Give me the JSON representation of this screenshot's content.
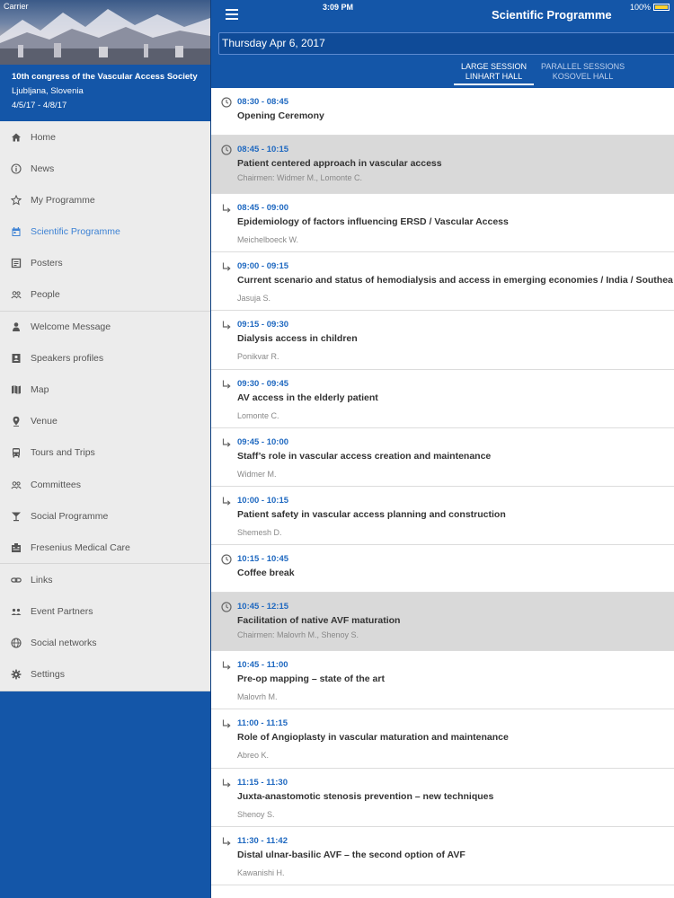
{
  "status_bar": {
    "carrier": "Carrier",
    "time": "3:09 PM",
    "battery": "100%"
  },
  "sidebar": {
    "conference_title": "10th congress of the Vascular Access Society",
    "location": "Ljubljana, Slovenia",
    "dates": "4/5/17 - 4/8/17",
    "groups": [
      [
        {
          "label": "Home",
          "icon": "home-icon"
        },
        {
          "label": "News",
          "icon": "info-icon"
        },
        {
          "label": "My Programme",
          "icon": "star-icon"
        },
        {
          "label": "Scientific Programme",
          "icon": "calendar-icon",
          "active": true
        },
        {
          "label": "Posters",
          "icon": "poster-icon"
        },
        {
          "label": "People",
          "icon": "people-icon"
        }
      ],
      [
        {
          "label": "Welcome Message",
          "icon": "speaker-icon"
        },
        {
          "label": "Speakers profiles",
          "icon": "contact-icon"
        },
        {
          "label": "Map",
          "icon": "map-icon"
        },
        {
          "label": "Venue",
          "icon": "pin-icon"
        },
        {
          "label": "Tours and Trips",
          "icon": "bus-icon"
        },
        {
          "label": "Committees",
          "icon": "group-icon"
        },
        {
          "label": "Social Programme",
          "icon": "cocktail-icon"
        },
        {
          "label": "Fresenius Medical Care",
          "icon": "building-icon"
        }
      ],
      [
        {
          "label": "Links",
          "icon": "link-icon"
        },
        {
          "label": "Event Partners",
          "icon": "partners-icon"
        },
        {
          "label": "Social networks",
          "icon": "globe-icon"
        },
        {
          "label": "Settings",
          "icon": "gear-icon"
        }
      ]
    ]
  },
  "header": {
    "title": "Scientific Programme",
    "date": "Thursday Apr 6, 2017",
    "tabs": [
      {
        "line1": "LARGE SESSION",
        "line2": "LINHART HALL",
        "active": true
      },
      {
        "line1": "PARALLEL SESSIONS",
        "line2": "KOSOVEL HALL",
        "active": false
      }
    ]
  },
  "programme": [
    {
      "kind": "plain",
      "time": "08:30 - 08:45",
      "title": "Opening Ceremony"
    },
    {
      "kind": "session",
      "time": "08:45 - 10:15",
      "title": "Patient centered approach in vascular access",
      "chairs": "Chairmen: Widmer M., Lomonte C."
    },
    {
      "kind": "talk",
      "time": "08:45 - 09:00",
      "title": "Epidemiology of factors influencing ERSD / Vascular Access",
      "speaker": "Meichelboeck W."
    },
    {
      "kind": "talk",
      "time": "09:00 - 09:15",
      "title": "Current scenario and status of hemodialysis and access in emerging economies / India / Southea",
      "speaker": "Jasuja S."
    },
    {
      "kind": "talk",
      "time": "09:15 - 09:30",
      "title": "Dialysis access in children",
      "speaker": "Ponikvar R."
    },
    {
      "kind": "talk",
      "time": "09:30 - 09:45",
      "title": "AV access in the elderly patient",
      "speaker": "Lomonte C."
    },
    {
      "kind": "talk",
      "time": "09:45 - 10:00",
      "title": "Staff’s role in vascular access creation and maintenance",
      "speaker": "Widmer M."
    },
    {
      "kind": "talk",
      "time": "10:00 - 10:15",
      "title": "Patient safety in vascular access planning and construction",
      "speaker": "Shemesh D."
    },
    {
      "kind": "plain",
      "time": "10:15 - 10:45",
      "title": "Coffee break"
    },
    {
      "kind": "session",
      "time": "10:45 - 12:15",
      "title": "Facilitation of native AVF maturation",
      "chairs": "Chairmen: Malovrh M., Shenoy S."
    },
    {
      "kind": "talk",
      "time": "10:45 - 11:00",
      "title": "Pre-op mapping – state of the art",
      "speaker": "Malovrh M."
    },
    {
      "kind": "talk",
      "time": "11:00 - 11:15",
      "title": "Role of Angioplasty in vascular maturation and maintenance",
      "speaker": "Abreo K."
    },
    {
      "kind": "talk",
      "time": "11:15 - 11:30",
      "title": "Juxta-anastomotic stenosis prevention – new techniques",
      "speaker": "Shenoy S."
    },
    {
      "kind": "talk",
      "time": "11:30 - 11:42",
      "title": "Distal ulnar-basilic AVF – the second option of AVF",
      "speaker": "Kawanishi H."
    }
  ]
}
